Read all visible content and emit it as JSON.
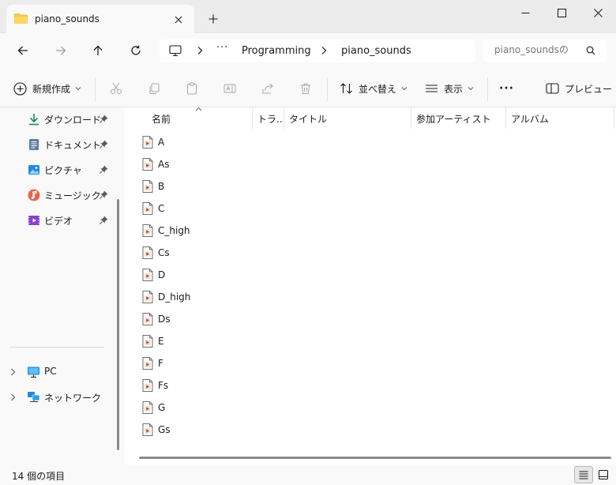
{
  "window": {
    "tab_title": "piano_sounds",
    "new_tab_symbol": "+"
  },
  "navigation": {
    "breadcrumb": [
      "Programming",
      "piano_sounds"
    ],
    "overflow": "···",
    "search_placeholder": "piano_soundsの"
  },
  "commands": {
    "new": "新規作成",
    "sort": "並べ替え",
    "view": "表示",
    "more": "···",
    "preview": "プレビュー"
  },
  "sidebar": {
    "quick_access": [
      {
        "label": "ダウンロード",
        "icon": "download-icon"
      },
      {
        "label": "ドキュメント",
        "icon": "documents-icon"
      },
      {
        "label": "ピクチャ",
        "icon": "pictures-icon"
      },
      {
        "label": "ミュージック",
        "icon": "music-icon"
      },
      {
        "label": "ビデオ",
        "icon": "videos-icon"
      }
    ],
    "tree": [
      {
        "label": "PC",
        "icon": "pc-icon"
      },
      {
        "label": "ネットワーク",
        "icon": "network-icon"
      }
    ]
  },
  "columns": [
    "名前",
    "トラ...",
    "タイトル",
    "参加アーティスト",
    "アルバム"
  ],
  "files": [
    "A",
    "As",
    "B",
    "C",
    "C_high",
    "Cs",
    "D",
    "D_high",
    "Ds",
    "E",
    "F",
    "Fs",
    "G",
    "Gs"
  ],
  "status": {
    "item_count": "14 個の項目"
  },
  "colors": {
    "accent": "#0067c0",
    "folder": "#f4c84a",
    "file_badge": "#c0502b"
  }
}
